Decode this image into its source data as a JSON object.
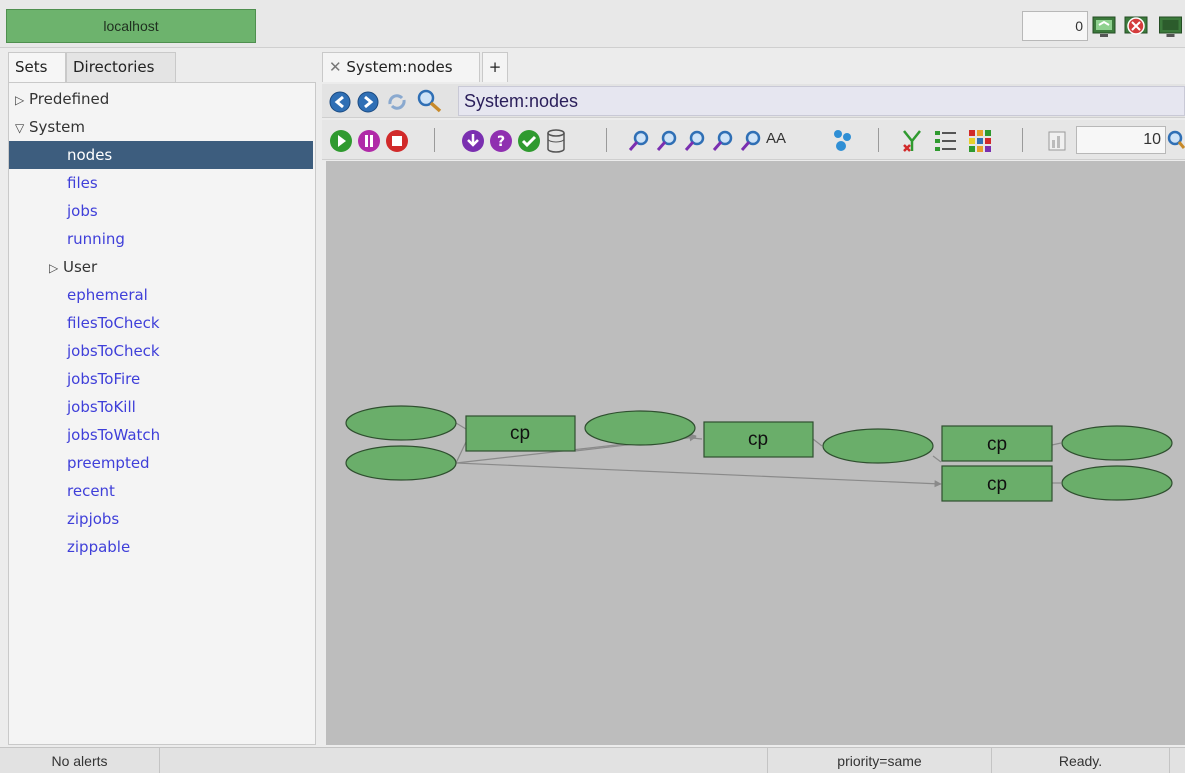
{
  "topbar": {
    "host_label": "localhost",
    "counter_value": "0"
  },
  "sidebar": {
    "tabs": [
      "Sets",
      "Directories"
    ],
    "tree": [
      {
        "label": "Predefined",
        "kind": "group-collapsed"
      },
      {
        "label": "System",
        "kind": "group-expanded"
      },
      {
        "label": "nodes",
        "kind": "selected"
      },
      {
        "label": "files",
        "kind": "link"
      },
      {
        "label": "jobs",
        "kind": "link"
      },
      {
        "label": "running",
        "kind": "link"
      },
      {
        "label": "User",
        "kind": "subgroup-collapsed"
      },
      {
        "label": "ephemeral",
        "kind": "link"
      },
      {
        "label": "filesToCheck",
        "kind": "link"
      },
      {
        "label": "jobsToCheck",
        "kind": "link"
      },
      {
        "label": "jobsToFire",
        "kind": "link"
      },
      {
        "label": "jobsToKill",
        "kind": "link"
      },
      {
        "label": "jobsToWatch",
        "kind": "link"
      },
      {
        "label": "preempted",
        "kind": "link"
      },
      {
        "label": "recent",
        "kind": "link"
      },
      {
        "label": "zipjobs",
        "kind": "link"
      },
      {
        "label": "zippable",
        "kind": "link"
      }
    ]
  },
  "content": {
    "tab_label": "System:nodes",
    "add_tab_label": "+",
    "path": "System:nodes",
    "limit_value": "10",
    "graph": {
      "box_label": "cp"
    }
  },
  "toolbar": {
    "font_size_label": "AA"
  },
  "statusbar": {
    "alerts": "No alerts",
    "priority": "priority=same",
    "state": "Ready."
  },
  "colors": {
    "node_fill": "#6aae6a",
    "selection": "#3d5d7e",
    "link": "#3f3fd9"
  }
}
